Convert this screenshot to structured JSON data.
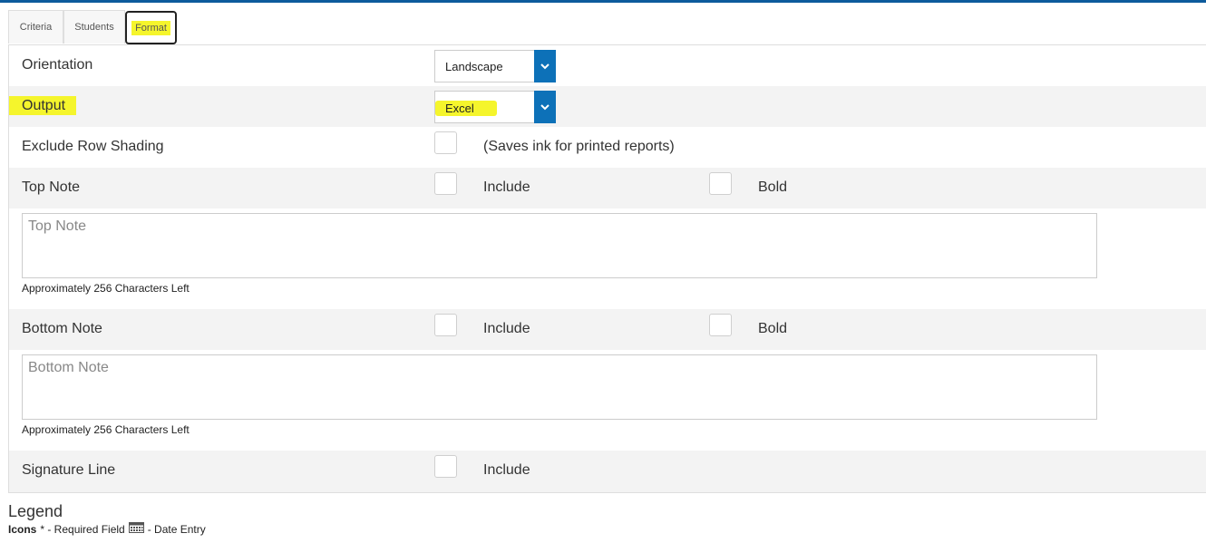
{
  "tabs": [
    {
      "label": "Criteria",
      "active": false
    },
    {
      "label": "Students",
      "active": false
    },
    {
      "label": "Format",
      "active": true
    }
  ],
  "rows": {
    "orientation": {
      "label": "Orientation",
      "value": "Landscape"
    },
    "output": {
      "label": "Output",
      "value": "Excel"
    },
    "exclude_shading": {
      "label": "Exclude Row Shading",
      "note": "(Saves ink for printed reports)"
    },
    "top_note": {
      "label": "Top Note",
      "include": "Include",
      "bold": "Bold",
      "placeholder": "Top Note",
      "chars_left": "Approximately 256 Characters Left"
    },
    "bottom_note": {
      "label": "Bottom Note",
      "include": "Include",
      "bold": "Bold",
      "placeholder": "Bottom Note",
      "chars_left": "Approximately 256 Characters Left"
    },
    "signature": {
      "label": "Signature Line",
      "include": "Include"
    }
  },
  "legend": {
    "title": "Legend",
    "icons_label": "Icons",
    "required_text": "* - Required Field",
    "date_text": "- Date Entry"
  },
  "colors": {
    "accent": "#0d71b8",
    "highlight": "#f5f52c",
    "row_shade": "#f3f3f3"
  }
}
